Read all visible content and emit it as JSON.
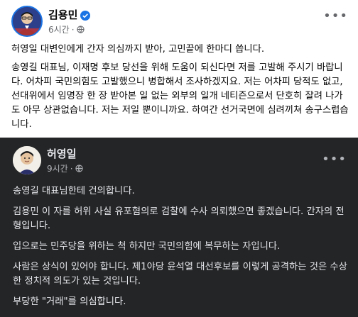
{
  "post": {
    "author": "김용민",
    "time": "6시간",
    "separator": "·",
    "paragraphs": [
      "허영일 대변인에게 간자 의심까지 받아, 고민끝에 한마디 씁니다.",
      "송영길 대표님, 이재명 후보 당선을 위해 도움이 되신다면 저를 고발해 주시기 바랍니다. 어차피 국민의힘도 고발했으니 병합해서 조사하겠지요. 저는 어차피 당적도 없고, 선대위에서 임명장 한 장 받아본 일 없는 외부의 일개 네티즌으로서 단호히 잘려 나가도 아무 상관없습니다. 저는 저일 뿐이니까요. 하여간 선거국면에 심려끼쳐 송구스럽습니다."
    ],
    "more_icon": "ellipsis-icon"
  },
  "shared_post": {
    "author": "허영일",
    "time": "9시간",
    "separator": "·",
    "paragraphs": [
      "송영길 대표님한테 건의합니다.",
      "김용민 이 자를 허위 사실 유포혐의로 검찰에 수사 의뢰했으면 좋겠습니다. 간자의 전형입니다.",
      "입으로는 민주당을 위하는 척 하지만 국민의힘에 복무하는 자입니다.",
      "사람은 상식이 있어야 합니다. 제1야당 윤석열 대선후보를 이렇게 공격하는 것은 수상한 정치적 의도가 있는 것입니다.",
      "부당한 \"거래\"를 의심합니다."
    ],
    "more_icon": "ellipsis-icon"
  },
  "colors": {
    "verified": "#1b74e4",
    "dark_bg": "#242526",
    "light_text": "#050505",
    "muted": "#65676b"
  }
}
